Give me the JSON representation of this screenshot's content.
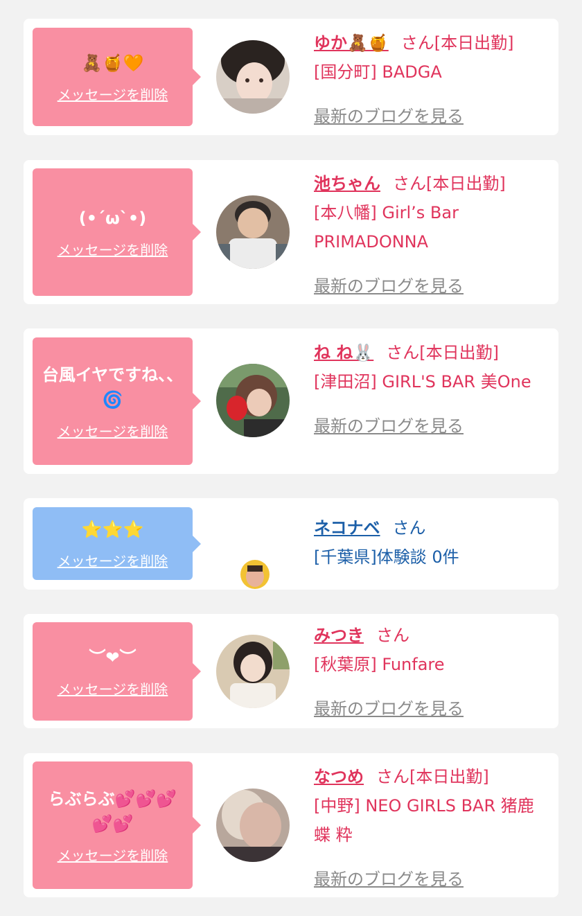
{
  "delete_label": "メッセージを削除",
  "blog_label": "最新のブログを見る",
  "honorific": "さん",
  "colors": {
    "accent_pink": "#e0345c",
    "bubble_pink": "#f98fa2",
    "bubble_blue": "#8fbdf5",
    "accent_blue": "#1c5fa8"
  },
  "items": [
    {
      "message": "🧸🍯🧡",
      "name": "ゆか🧸🍯",
      "status": "[本日出勤]",
      "shop": "[国分町] BADGA",
      "avatar": "avatar-photo"
    },
    {
      "message": "(•´ω`•)",
      "name": "池ちゃん",
      "status": "[本日出勤]",
      "shop": "[本八幡] Girl’s Bar PRIMADONNA",
      "avatar": "avatar-photo"
    },
    {
      "message": "台風イヤですね、、🌀",
      "name": "ね ね🐰",
      "status": "[本日出勤]",
      "shop": "[津田沼] GIRL'S BAR 美One",
      "avatar": "avatar-photo"
    },
    {
      "message": "⭐⭐⭐",
      "name": "ネコナベ",
      "status": "",
      "shop": "[千葉県]体験談 0件",
      "avatar": "avatar-photo-small"
    },
    {
      "message": "︶❤︶",
      "name": "みつき",
      "status": "",
      "shop": "[秋葉原] Funfare",
      "avatar": "avatar-photo"
    },
    {
      "message": "らぶらぶ💕💕💕💕💕",
      "name": "なつめ",
      "status": "[本日出勤]",
      "shop": "[中野] NEO GIRLS BAR 猪鹿蝶 粋",
      "avatar": "avatar-photo"
    }
  ]
}
